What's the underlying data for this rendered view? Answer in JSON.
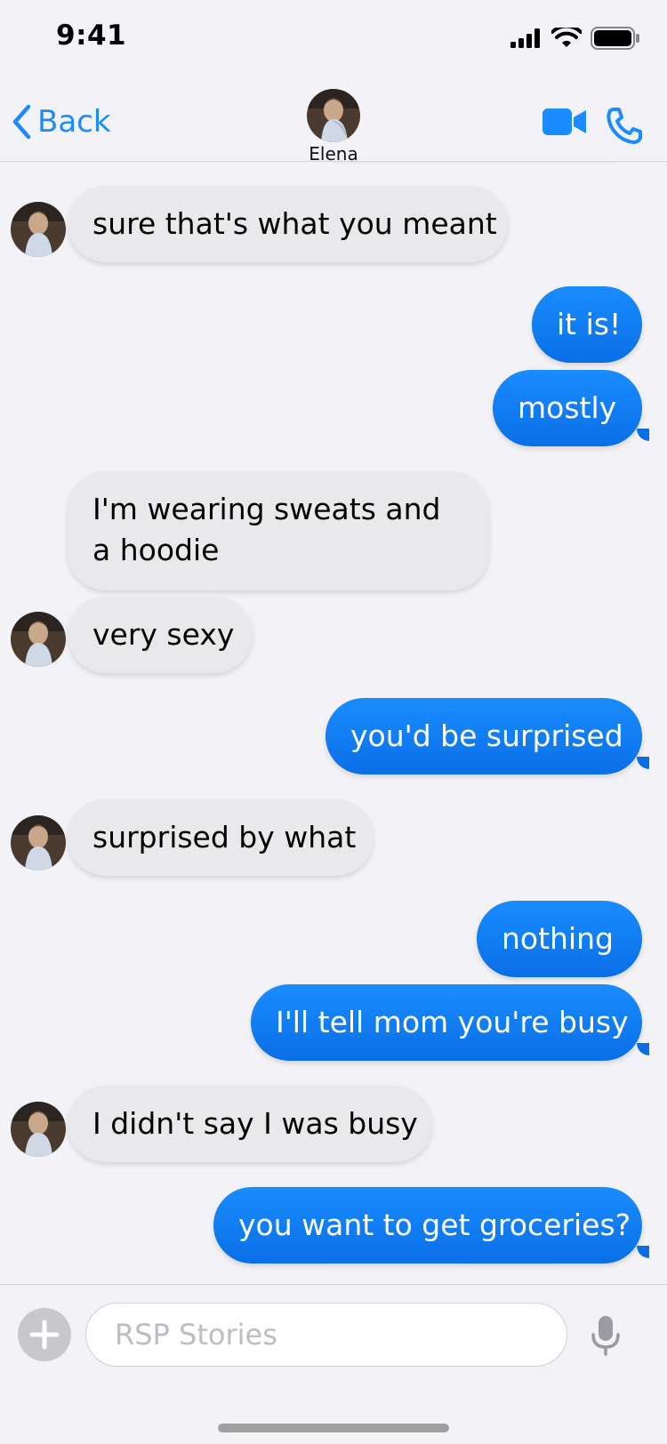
{
  "status_bar": {
    "time": "9:41"
  },
  "header": {
    "back_label": "Back",
    "contact_name": "Elena"
  },
  "messages": [
    {
      "side": "in",
      "text": "sure that's what you meant",
      "avatar": true
    },
    {
      "side": "out",
      "text": "it is!"
    },
    {
      "side": "out",
      "text": "mostly"
    },
    {
      "side": "in",
      "text": "I'm wearing sweats and a hoodie",
      "avatar": false
    },
    {
      "side": "in",
      "text": "very sexy",
      "avatar": true
    },
    {
      "side": "out",
      "text": "you'd be surprised"
    },
    {
      "side": "in",
      "text": "surprised by what",
      "avatar": true
    },
    {
      "side": "out",
      "text": "nothing"
    },
    {
      "side": "out",
      "text": "I'll tell mom you're busy"
    },
    {
      "side": "in",
      "text": "I didn't say I was busy",
      "avatar": true
    },
    {
      "side": "out",
      "text": "you want to get groceries?"
    }
  ],
  "composer": {
    "placeholder": "RSP Stories"
  },
  "colors": {
    "accent": "#1a8cff",
    "outgoing_bubble": "#0a6fe6",
    "incoming_bubble": "#e9e9eb",
    "background": "#f2f2f7"
  },
  "icons": [
    "chevron-left-icon",
    "video-camera-icon",
    "phone-icon",
    "plus-icon",
    "microphone-icon",
    "signal-icon",
    "wifi-icon",
    "battery-icon"
  ]
}
